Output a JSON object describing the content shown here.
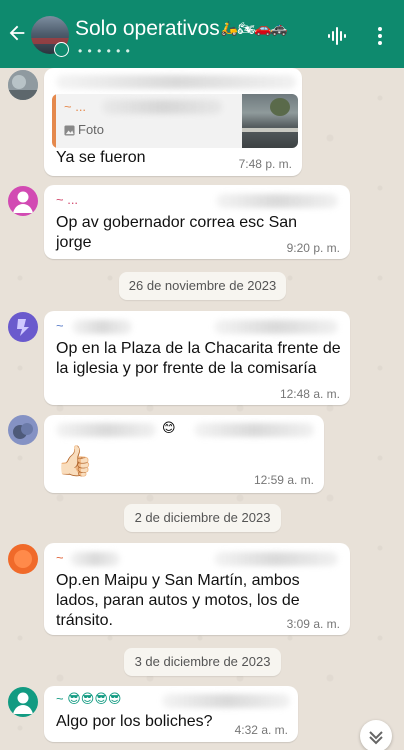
{
  "header": {
    "title": "Solo operativos",
    "title_emoji": "🛵🏍🚗🚓",
    "subtitle": "• • • • • •"
  },
  "colors": {
    "header_bg": "#0e8a6e",
    "chat_bg": "#e8e1d8",
    "bubble_bg": "#ffffff"
  },
  "icons": [
    "back-arrow-icon",
    "voice-call-icon",
    "more-options-icon",
    "photo-icon",
    "chevron-down-icon"
  ],
  "messages": [
    {
      "sender_prefix": "",
      "quote": {
        "name": "~ ...",
        "phone": "+54 9 ...",
        "label": "Foto"
      },
      "text": "Ya se fueron",
      "time": "7:48 p. m."
    },
    {
      "sender_prefix": "~ ...",
      "text": "Op av gobernador correa esc San jorge",
      "time": "9:20 p. m."
    },
    {
      "sender_prefix": "~",
      "text": "Op en la Plaza de la Chacarita frente de la iglesia y por frente de la comisaría",
      "time": "12:48 a. m."
    },
    {
      "sender_prefix": "",
      "sender_emoji": "😊",
      "text": "👍🏻",
      "time": "12:59 a. m."
    },
    {
      "sender_prefix": "~",
      "text": "Op.en Maipu y San Martín, ambos lados, paran autos y motos, los de tránsito.",
      "time": "3:09 a. m."
    },
    {
      "sender_prefix": "~",
      "sender_emoji": "😎😎😎😎",
      "text": "Algo por los boliches?",
      "time": "4:32 a. m."
    }
  ],
  "dates": [
    "26 de noviembre de 2023",
    "2 de diciembre de 2023",
    "3 de diciembre de 2023"
  ]
}
